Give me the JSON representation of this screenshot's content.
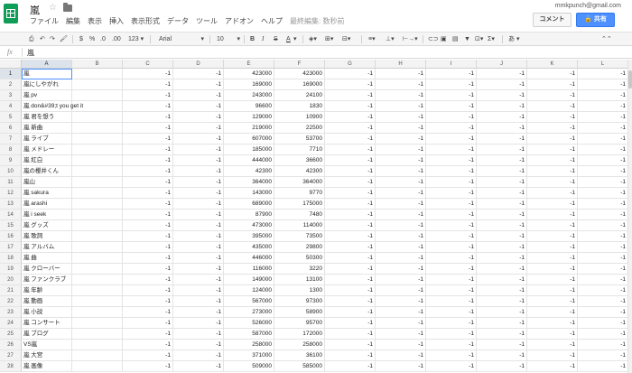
{
  "header": {
    "doc_title": "嵐",
    "account_email": "mmkpunch@gmail.com",
    "comment_button": "コメント",
    "share_button": "共有",
    "menu": [
      "ファイル",
      "編集",
      "表示",
      "挿入",
      "表示形式",
      "データ",
      "ツール",
      "アドオン",
      "ヘルプ"
    ],
    "autosave_note": "最終編集: 数秒前"
  },
  "toolbar": {
    "percent": "%",
    "decimal_less": ".0",
    "decimal_more": ".00",
    "number_format": "123",
    "font": "Arial",
    "font_size": "10",
    "bold": "B",
    "italic": "I",
    "strike": "S",
    "text_color": "A",
    "input_tools": "あ"
  },
  "formula_bar": {
    "fx_label": "fx",
    "value": "嵐"
  },
  "sheet": {
    "columns": [
      "A",
      "B",
      "C",
      "D",
      "E",
      "F",
      "G",
      "H",
      "I",
      "J",
      "K",
      "L"
    ],
    "selected_column": "A",
    "selected_row": 1,
    "rows": [
      {
        "n": "1",
        "a": "嵐",
        "c": "-1",
        "d": "-1",
        "e": "423000",
        "f": "423000"
      },
      {
        "n": "2",
        "a": "嵐にしやがれ",
        "c": "-1",
        "d": "-1",
        "e": "169000",
        "f": "169000"
      },
      {
        "n": "3",
        "a": "嵐 pv",
        "c": "-1",
        "d": "-1",
        "e": "243000",
        "f": "24100"
      },
      {
        "n": "4",
        "a": "嵐 don&#39;t you get it",
        "c": "-1",
        "d": "-1",
        "e": "96600",
        "f": "1830"
      },
      {
        "n": "5",
        "a": "嵐 君を想う",
        "c": "-1",
        "d": "-1",
        "e": "129000",
        "f": "10900"
      },
      {
        "n": "6",
        "a": "嵐 新曲",
        "c": "-1",
        "d": "-1",
        "e": "219000",
        "f": "22500"
      },
      {
        "n": "7",
        "a": "嵐 ライブ",
        "c": "-1",
        "d": "-1",
        "e": "607000",
        "f": "53700"
      },
      {
        "n": "8",
        "a": "嵐 メドレー",
        "c": "-1",
        "d": "-1",
        "e": "185000",
        "f": "7710"
      },
      {
        "n": "9",
        "a": "嵐 紅白",
        "c": "-1",
        "d": "-1",
        "e": "444000",
        "f": "36600"
      },
      {
        "n": "10",
        "a": "嵐の櫻井くん",
        "c": "-1",
        "d": "-1",
        "e": "42300",
        "f": "42300"
      },
      {
        "n": "11",
        "a": "嵐山",
        "c": "-1",
        "d": "-1",
        "e": "364000",
        "f": "364000"
      },
      {
        "n": "12",
        "a": "嵐 sakura",
        "c": "-1",
        "d": "-1",
        "e": "143000",
        "f": "9770"
      },
      {
        "n": "13",
        "a": "嵐 arashi",
        "c": "-1",
        "d": "-1",
        "e": "689000",
        "f": "175000"
      },
      {
        "n": "14",
        "a": "嵐 i seek",
        "c": "-1",
        "d": "-1",
        "e": "87900",
        "f": "7480"
      },
      {
        "n": "15",
        "a": "嵐 グッズ",
        "c": "-1",
        "d": "-1",
        "e": "473000",
        "f": "114000"
      },
      {
        "n": "16",
        "a": "嵐 歌詞",
        "c": "-1",
        "d": "-1",
        "e": "395000",
        "f": "73500"
      },
      {
        "n": "17",
        "a": "嵐 アルバム",
        "c": "-1",
        "d": "-1",
        "e": "435000",
        "f": "29800"
      },
      {
        "n": "18",
        "a": "嵐 曲",
        "c": "-1",
        "d": "-1",
        "e": "446000",
        "f": "50300"
      },
      {
        "n": "19",
        "a": "嵐 クローバー",
        "c": "-1",
        "d": "-1",
        "e": "116000",
        "f": "3220"
      },
      {
        "n": "20",
        "a": "嵐 ファンクラブ",
        "c": "-1",
        "d": "-1",
        "e": "149000",
        "f": "13100"
      },
      {
        "n": "21",
        "a": "嵐 年齢",
        "c": "-1",
        "d": "-1",
        "e": "124000",
        "f": "1300"
      },
      {
        "n": "22",
        "a": "嵐 動画",
        "c": "-1",
        "d": "-1",
        "e": "567000",
        "f": "97300"
      },
      {
        "n": "23",
        "a": "嵐 小説",
        "c": "-1",
        "d": "-1",
        "e": "273000",
        "f": "58900"
      },
      {
        "n": "24",
        "a": "嵐 コンサート",
        "c": "-1",
        "d": "-1",
        "e": "526000",
        "f": "95700"
      },
      {
        "n": "25",
        "a": "嵐 ブログ",
        "c": "-1",
        "d": "-1",
        "e": "587000",
        "f": "172000"
      },
      {
        "n": "26",
        "a": "VS嵐",
        "c": "-1",
        "d": "-1",
        "e": "258000",
        "f": "258000"
      },
      {
        "n": "27",
        "a": "嵐 大宮",
        "c": "-1",
        "d": "-1",
        "e": "371000",
        "f": "36100"
      },
      {
        "n": "28",
        "a": "嵐 画像",
        "c": "-1",
        "d": "-1",
        "e": "509000",
        "f": "585000"
      }
    ],
    "filler_value": "-1"
  },
  "colors": {
    "accent_blue": "#4d90fe",
    "sheets_green": "#0f9d58"
  }
}
